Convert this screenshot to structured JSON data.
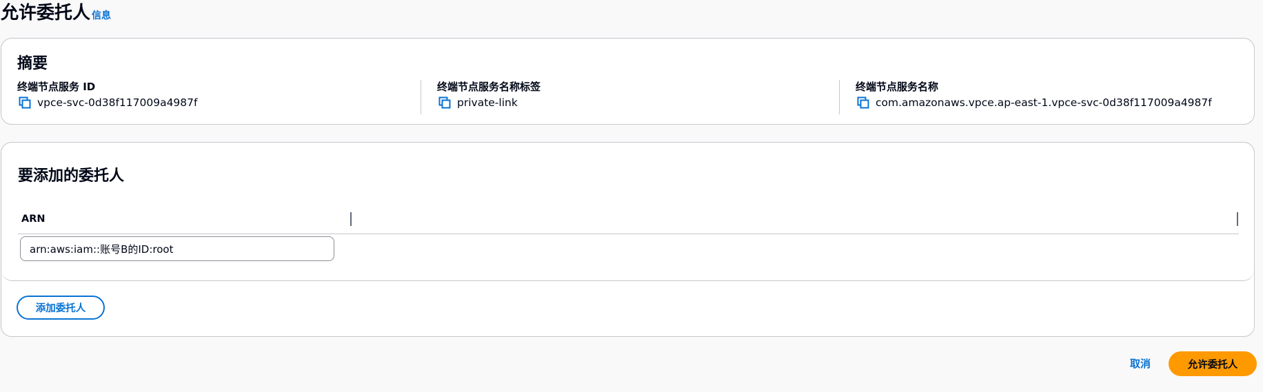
{
  "header": {
    "title": "允许委托人",
    "info_link": "信息"
  },
  "summary": {
    "heading": "摘要",
    "items": [
      {
        "label": "终端节点服务 ID",
        "value": "vpce-svc-0d38f117009a4987f",
        "icon": "copy-icon"
      },
      {
        "label": "终端节点服务名称标签",
        "value": "private-link",
        "icon": "copy-icon"
      },
      {
        "label": "终端节点服务名称",
        "value": "com.amazonaws.vpce.ap-east-1.vpce-svc-0d38f117009a4987f",
        "icon": "copy-icon"
      }
    ]
  },
  "principals": {
    "heading": "要添加的委托人",
    "columns": [
      "ARN"
    ],
    "rows": [
      {
        "arn_value": "arn:aws:iam::账号B的ID:root"
      }
    ],
    "add_button": "添加委托人"
  },
  "footer": {
    "cancel": "取消",
    "submit": "允许委托人"
  },
  "colors": {
    "link": "#0972d3",
    "primary": "#ff9900",
    "border": "#c6c6cd"
  }
}
